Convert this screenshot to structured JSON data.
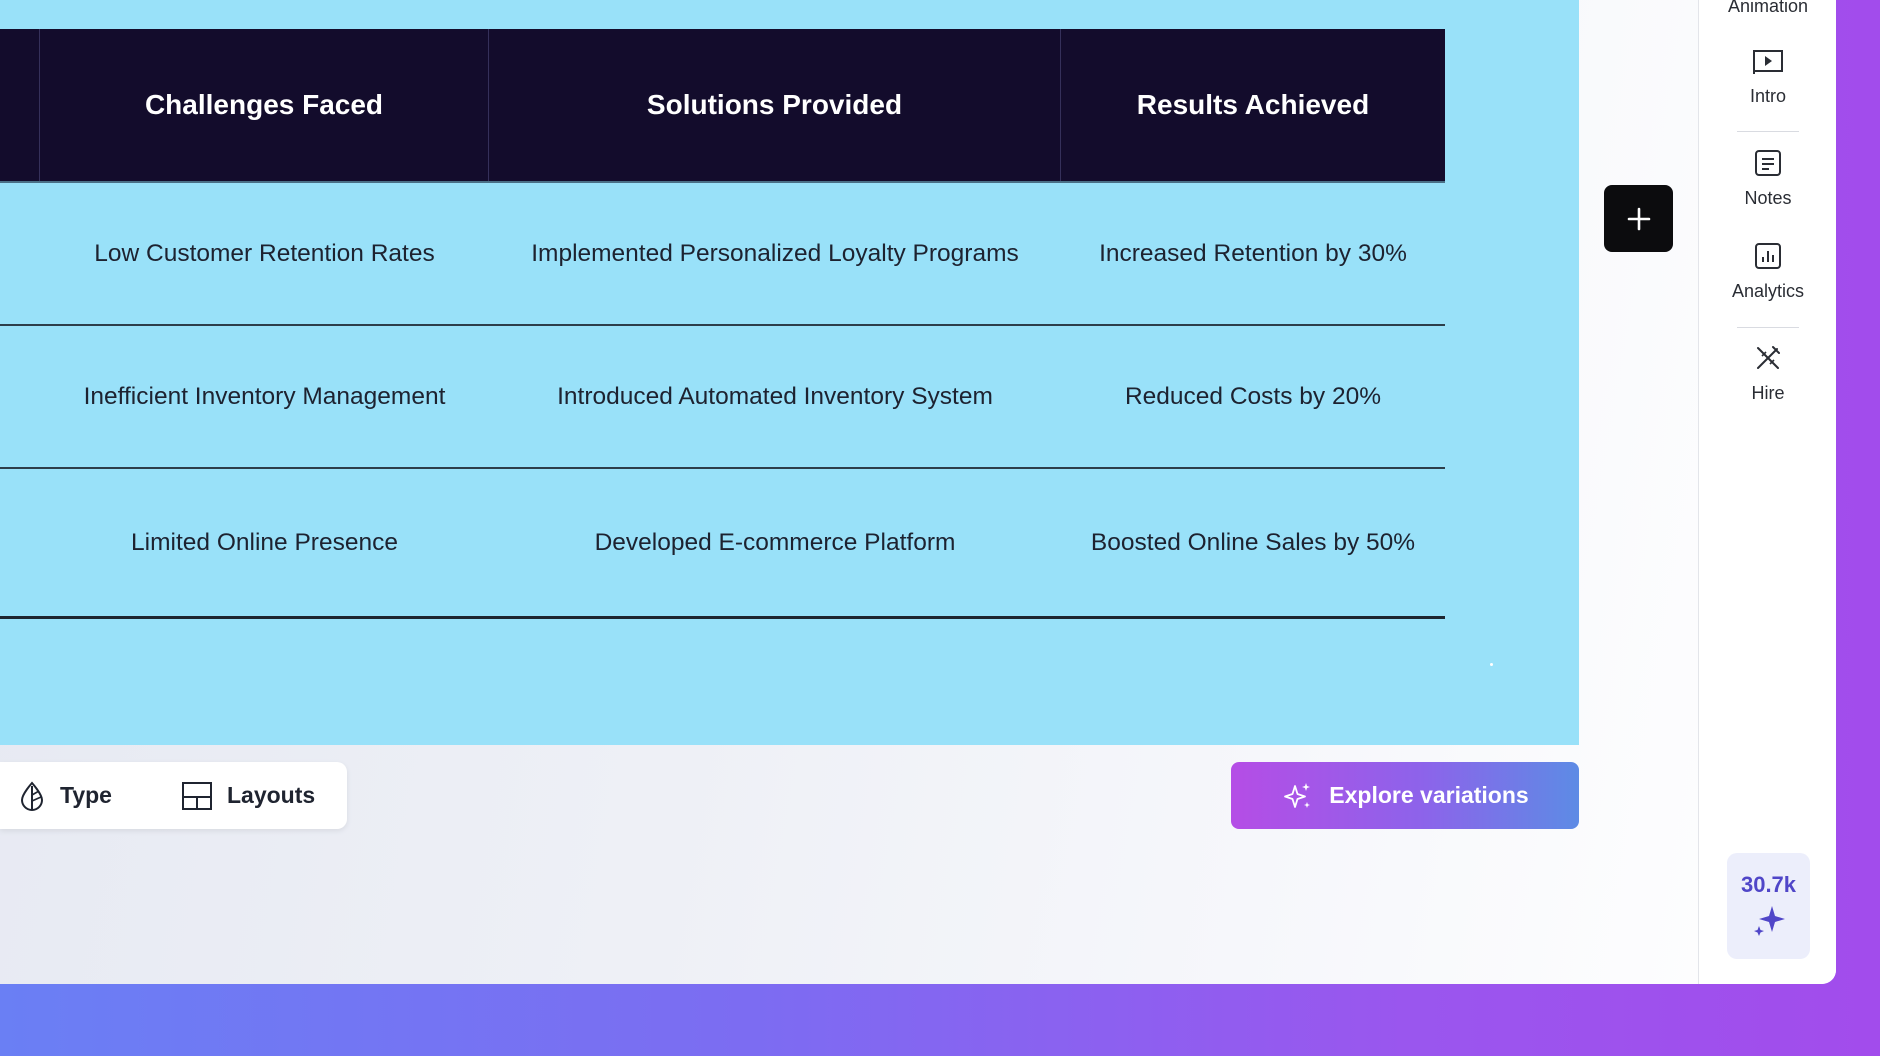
{
  "table": {
    "headers": [
      "Challenges Faced",
      "Solutions Provided",
      "Results Achieved"
    ],
    "rows": [
      [
        "Low Customer Retention Rates",
        "Implemented Personalized Loyalty Programs",
        "Increased Retention by 30%"
      ],
      [
        "Inefficient Inventory Management",
        "Introduced Automated Inventory System",
        "Reduced Costs by 20%"
      ],
      [
        "Limited Online Presence",
        "Developed E-commerce Platform",
        "Boosted Online Sales by 50%"
      ]
    ]
  },
  "toolbar": {
    "type_label": "Type",
    "layouts_label": "Layouts"
  },
  "explore": {
    "label": "Explore variations"
  },
  "sidebar": {
    "animation_label": "Animation",
    "items": [
      {
        "label": "Intro",
        "icon": "play-icon"
      },
      {
        "label": "Notes",
        "icon": "notes-icon"
      },
      {
        "label": "Analytics",
        "icon": "analytics-icon"
      },
      {
        "label": "Hire",
        "icon": "hire-icon"
      }
    ],
    "credits": "30.7k"
  },
  "colors": {
    "slide_bg": "#99e1f9",
    "header_bg": "#130c2c",
    "accent_purple": "#b54de6",
    "accent_blue": "#5d8be5"
  }
}
